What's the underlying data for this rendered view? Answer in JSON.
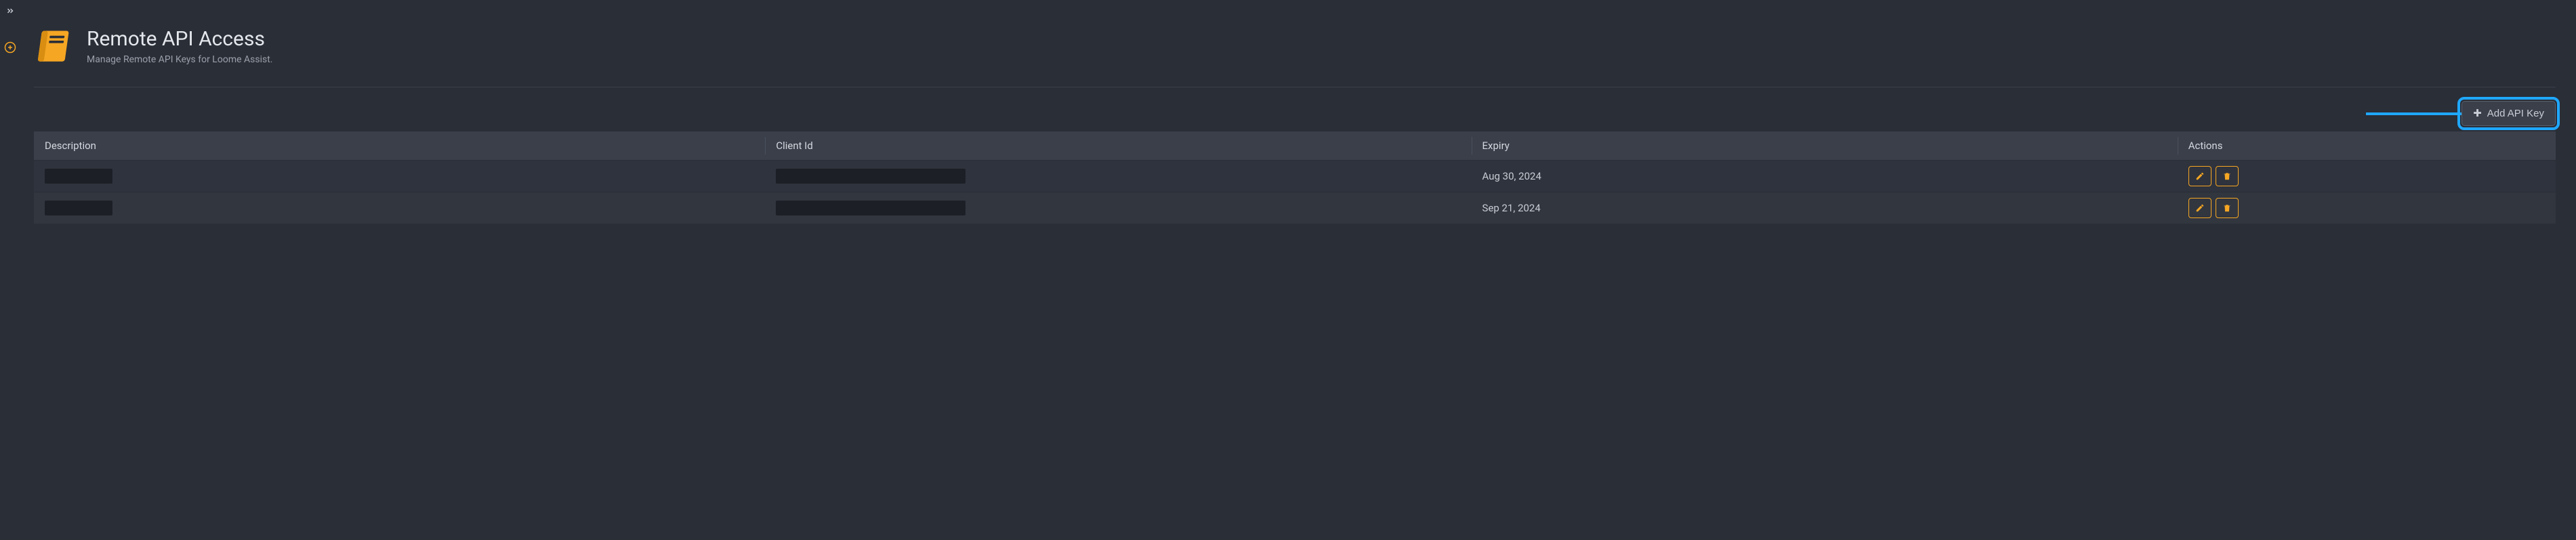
{
  "sidebar": {
    "expand_icon": "chevron-double-right",
    "add_icon": "plus-circle"
  },
  "header": {
    "title": "Remote API Access",
    "subtitle": "Manage Remote API Keys for Loome Assist."
  },
  "toolbar": {
    "add_button_label": "Add API Key"
  },
  "table": {
    "columns": {
      "description": "Description",
      "client_id": "Client Id",
      "expiry": "Expiry",
      "actions": "Actions"
    },
    "rows": [
      {
        "description": "",
        "client_id": "",
        "expiry": "Aug 30, 2024"
      },
      {
        "description": "",
        "client_id": "",
        "expiry": "Sep 21, 2024"
      }
    ]
  },
  "colors": {
    "accent": "#f5a623",
    "highlight": "#1fa8ff",
    "bg": "#2a2e37"
  }
}
